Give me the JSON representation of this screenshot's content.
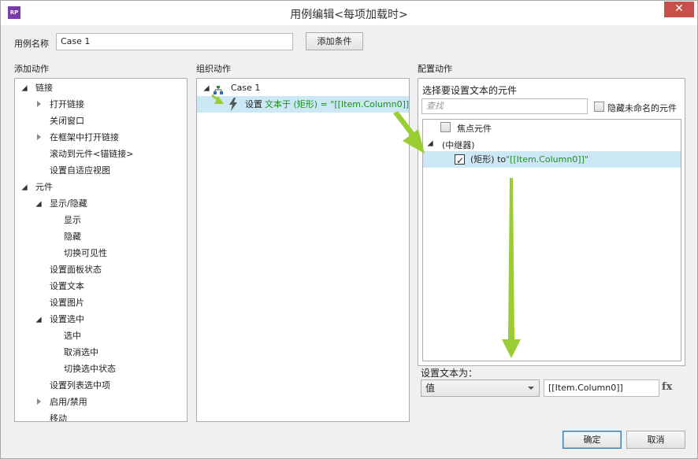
{
  "window": {
    "app_icon": "RP",
    "title": "用例编辑<每项加载时>",
    "close_icon": "close-icon"
  },
  "header": {
    "case_name_label": "用例名称",
    "case_name_value": "Case 1",
    "add_condition_button": "添加条件"
  },
  "left": {
    "heading": "添加动作",
    "items": [
      {
        "label": "链接",
        "level": 0,
        "state": "open"
      },
      {
        "label": "打开链接",
        "level": 1,
        "state": "closed"
      },
      {
        "label": "关闭窗口",
        "level": 1,
        "state": "none"
      },
      {
        "label": "在框架中打开链接",
        "level": 1,
        "state": "closed"
      },
      {
        "label": "滚动到元件<锚链接>",
        "level": 1,
        "state": "none"
      },
      {
        "label": "设置自适应视图",
        "level": 1,
        "state": "none"
      },
      {
        "label": "元件",
        "level": 0,
        "state": "open"
      },
      {
        "label": "显示/隐藏",
        "level": 1,
        "state": "open"
      },
      {
        "label": "显示",
        "level": 2,
        "state": "none"
      },
      {
        "label": "隐藏",
        "level": 2,
        "state": "none"
      },
      {
        "label": "切换可见性",
        "level": 2,
        "state": "none"
      },
      {
        "label": "设置面板状态",
        "level": 1,
        "state": "none"
      },
      {
        "label": "设置文本",
        "level": 1,
        "state": "none"
      },
      {
        "label": "设置图片",
        "level": 1,
        "state": "none"
      },
      {
        "label": "设置选中",
        "level": 1,
        "state": "open"
      },
      {
        "label": "选中",
        "level": 2,
        "state": "none"
      },
      {
        "label": "取消选中",
        "level": 2,
        "state": "none"
      },
      {
        "label": "切换选中状态",
        "level": 2,
        "state": "none"
      },
      {
        "label": "设置列表选中项",
        "level": 1,
        "state": "none"
      },
      {
        "label": "启用/禁用",
        "level": 1,
        "state": "closed"
      },
      {
        "label": "移动",
        "level": 1,
        "state": "none"
      }
    ]
  },
  "middle": {
    "heading": "组织动作",
    "case_label": "Case 1",
    "action_prefix": "设置",
    "action_detail": "文本于 (矩形) = \"[[Item.Column0]]\""
  },
  "right": {
    "heading": "配置动作",
    "subheading": "选择要设置文本的元件",
    "search_placeholder": "查找",
    "hide_unnamed_label": "隐藏未命名的元件",
    "tree": {
      "focus_element": "焦点元件",
      "repeater": "(中继器)",
      "item_prefix": "(矩形) to",
      "item_value": "\"[[Item.Column0]]\""
    },
    "set_text_label": "设置文本为：",
    "value_type": "值",
    "value_text": "[[Item.Column0]]",
    "fx_label": "fx"
  },
  "footer": {
    "ok": "确定",
    "cancel": "取消"
  },
  "colors": {
    "accent_green": "#9acd32",
    "selection": "#cde8f5",
    "close_red": "#c7504a"
  }
}
